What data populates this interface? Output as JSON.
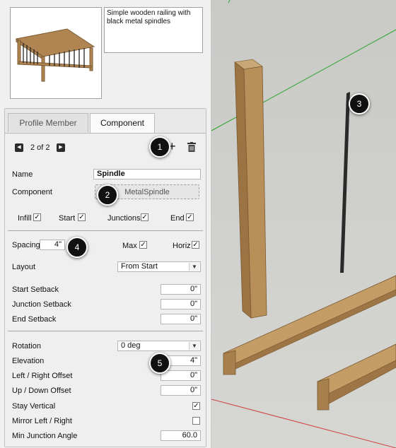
{
  "description": "Simple wooden railing with black metal spindles",
  "tabs": [
    "Profile Member",
    "Component"
  ],
  "nav": {
    "position": "2 of 2"
  },
  "fields": {
    "name_label": "Name",
    "name_value": "Spindle",
    "component_label": "Component",
    "component_value": "MetalSpindle",
    "infill": "Infill",
    "start": "Start",
    "junctions": "Junctions",
    "end": "End",
    "spacing_label": "Spacing",
    "spacing_value": "4\"",
    "max": "Max",
    "horiz": "Horiz",
    "layout_label": "Layout",
    "layout_value": "From Start",
    "start_setback_label": "Start Setback",
    "start_setback_value": "0\"",
    "junction_setback_label": "Junction Setback",
    "junction_setback_value": "0\"",
    "end_setback_label": "End Setback",
    "end_setback_value": "0\"",
    "rotation_label": "Rotation",
    "rotation_value": "0 deg",
    "elevation_label": "Elevation",
    "elevation_value": "4\"",
    "lr_offset_label": "Left / Right Offset",
    "lr_offset_value": "0\"",
    "ud_offset_label": "Up / Down Offset",
    "ud_offset_value": "0\"",
    "stay_vertical_label": "Stay Vertical",
    "mirror_label": "Mirror Left / Right",
    "min_junction_label": "Min Junction Angle",
    "min_junction_value": "60.0"
  },
  "checkboxes": {
    "infill": true,
    "start": true,
    "junctions": true,
    "end": true,
    "max": true,
    "horiz": true,
    "stay_vertical": true,
    "mirror": false
  },
  "icons": {
    "add": "plus-icon",
    "delete": "trash-icon",
    "prev": "prev-icon",
    "next": "next-icon"
  },
  "badges": [
    "1",
    "2",
    "3",
    "4",
    "5"
  ],
  "colors": {
    "wood": "#b58d5a",
    "spindle": "#2a2a2a",
    "axis_green": "#2fa52f",
    "axis_red": "#d04040",
    "viewport_bg": "#cfcfcc"
  }
}
